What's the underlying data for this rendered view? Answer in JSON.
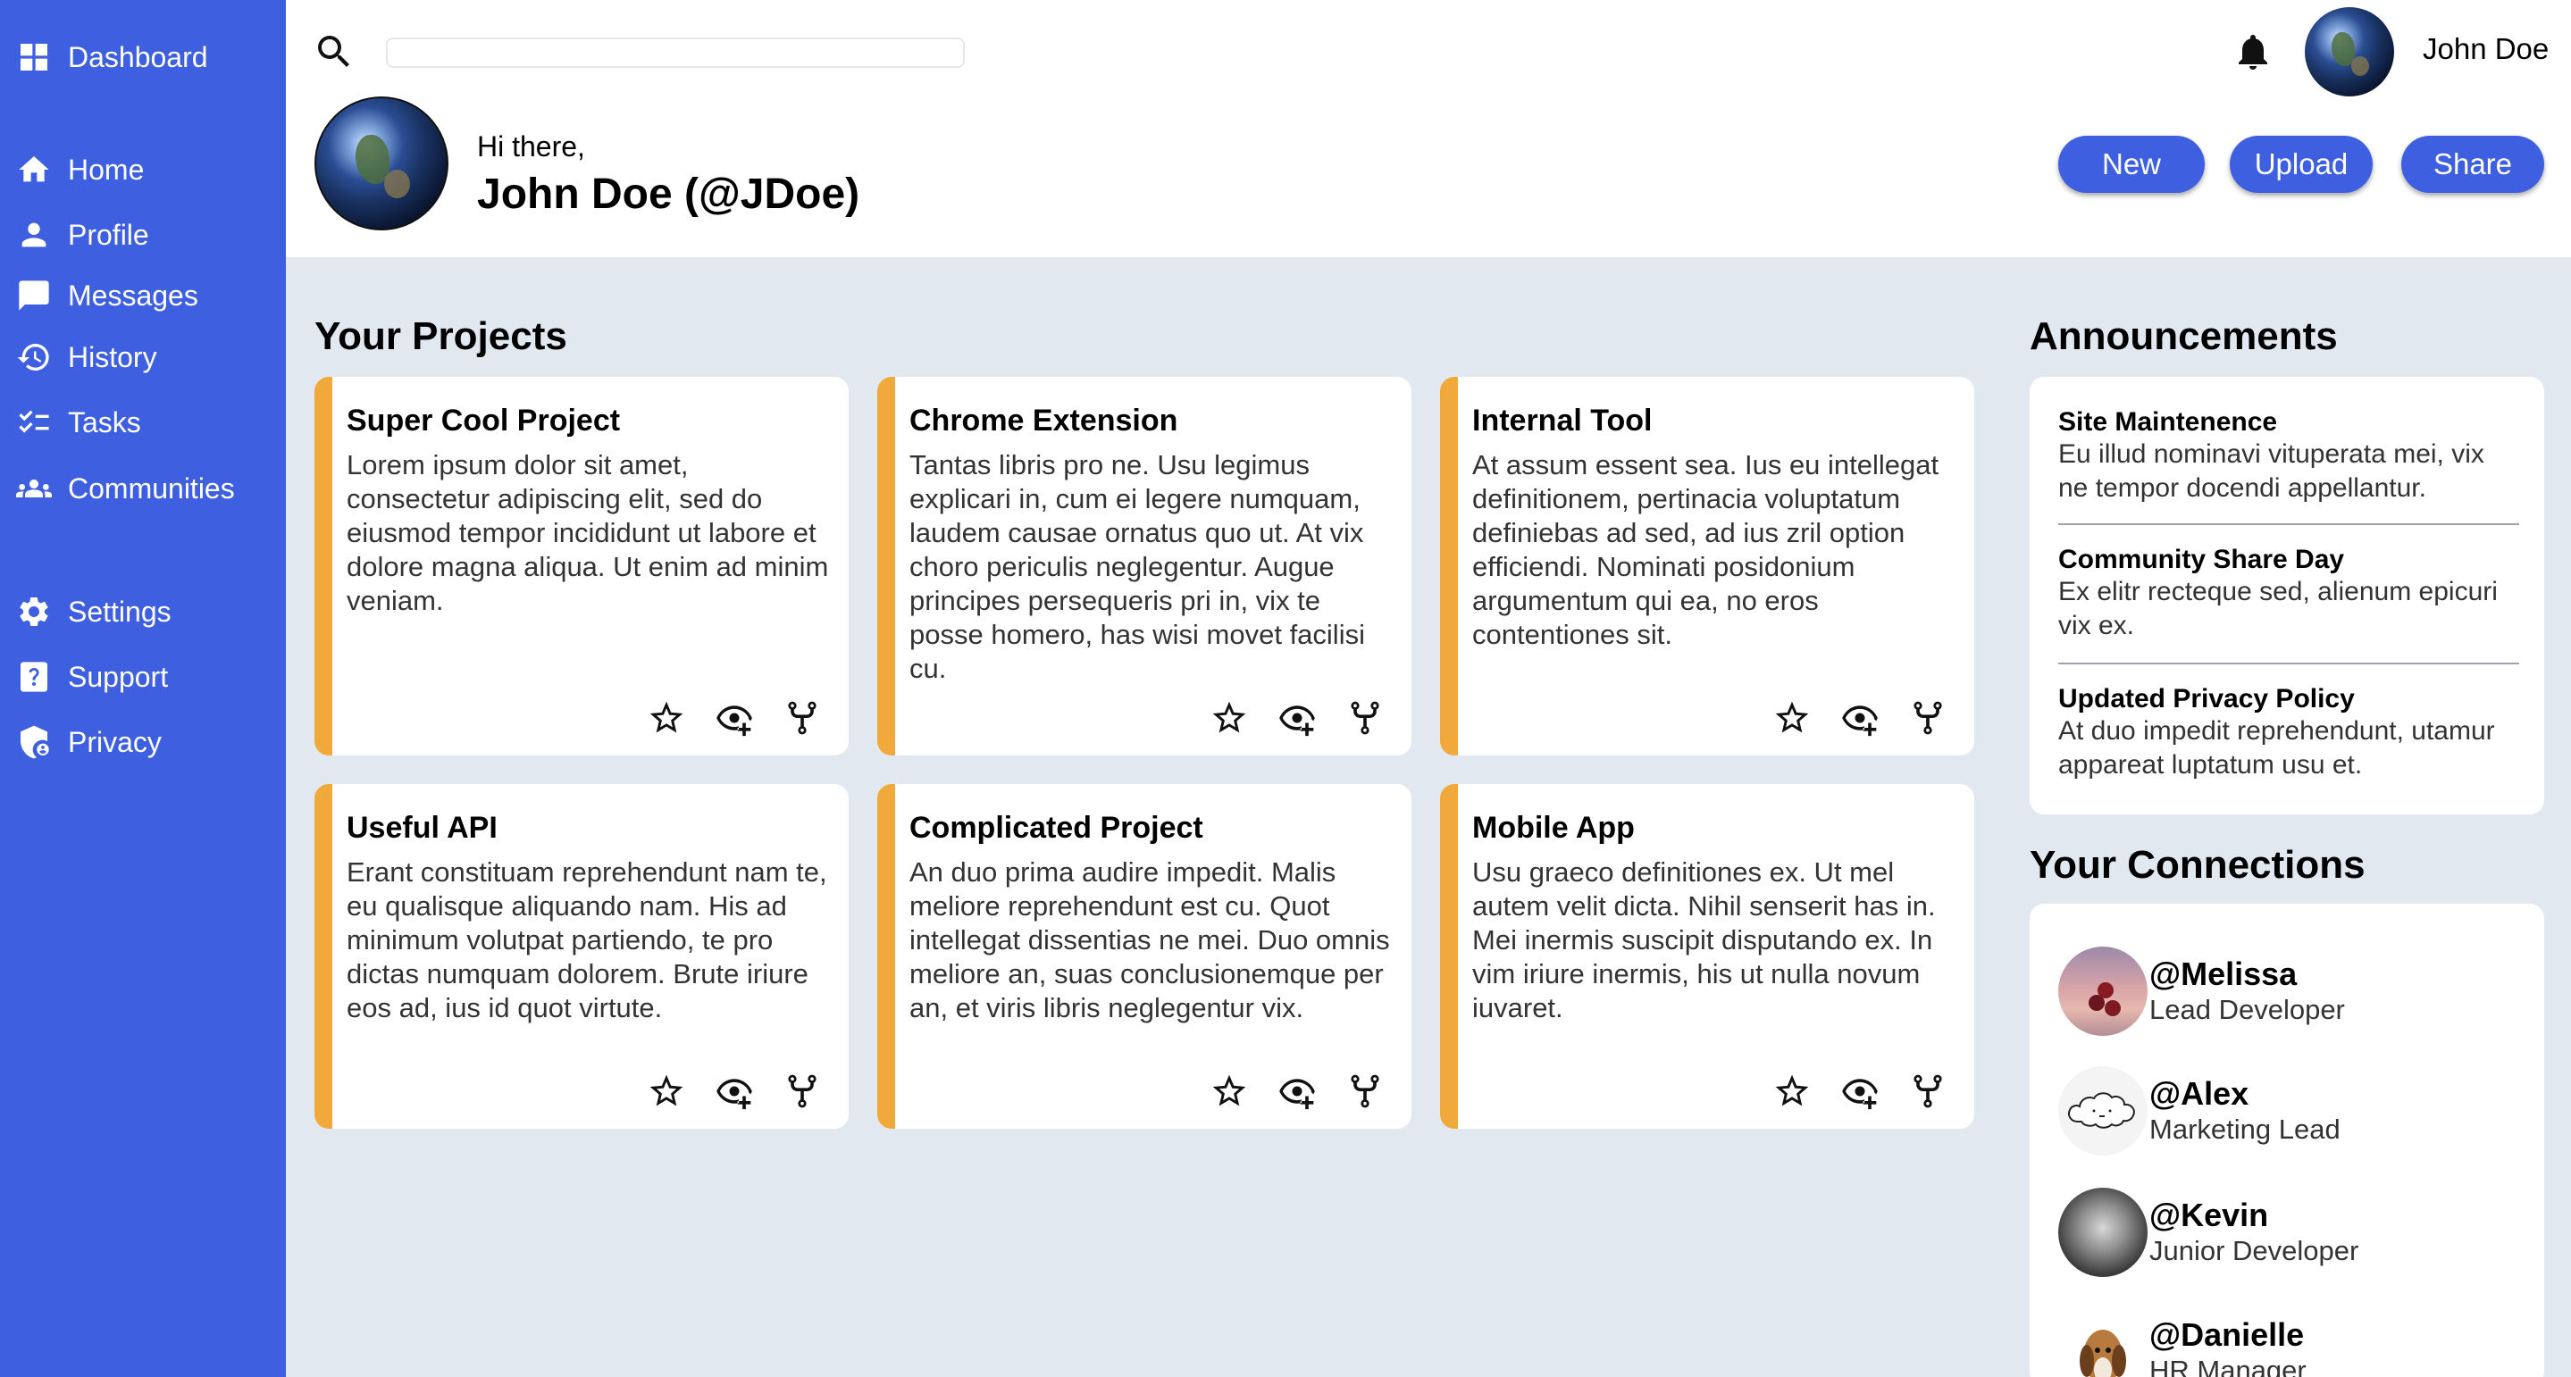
{
  "sidebar": {
    "dashboard": "Dashboard",
    "items": [
      {
        "label": "Home"
      },
      {
        "label": "Profile"
      },
      {
        "label": "Messages"
      },
      {
        "label": "History"
      },
      {
        "label": "Tasks"
      },
      {
        "label": "Communities"
      },
      {
        "label": "Settings"
      },
      {
        "label": "Support"
      },
      {
        "label": "Privacy"
      }
    ]
  },
  "header": {
    "search_placeholder": "",
    "username": "John Doe",
    "greeting": "Hi there,",
    "full_name": "John Doe (@JDoe)",
    "buttons": {
      "new": "New",
      "upload": "Upload",
      "share": "Share"
    }
  },
  "projects": {
    "title": "Your Projects",
    "cards": [
      {
        "title": "Super Cool Project",
        "desc": "Lorem ipsum dolor sit amet, consectetur adipiscing elit, sed do eiusmod tempor incididunt ut labore et dolore magna aliqua. Ut enim ad minim veniam."
      },
      {
        "title": "Chrome Extension",
        "desc": "Tantas libris pro ne. Usu legimus explicari in, cum ei legere numquam, laudem causae ornatus quo ut. At vix choro periculis neglegentur. Augue principes persequeris pri in, vix te posse homero, has wisi movet facilisi cu."
      },
      {
        "title": "Internal Tool",
        "desc": "At assum essent sea. Ius eu intellegat definitionem, pertinacia voluptatum definiebas ad sed, ad ius zril option efficiendi. Nominati posidonium argumentum qui ea, no eros contentiones sit."
      },
      {
        "title": "Useful API",
        "desc": "Erant constituam reprehendunt nam te, eu qualisque aliquando nam. His ad minimum volutpat partiendo, te pro dictas numquam dolorem. Brute iriure eos ad, ius id quot virtute."
      },
      {
        "title": "Complicated Project",
        "desc": "An duo prima audire impedit. Malis meliore reprehendunt est cu. Quot intellegat dissentias ne mei. Duo omnis meliore an, suas conclusionemque per an, et viris libris neglegentur vix."
      },
      {
        "title": "Mobile App",
        "desc": "Usu graeco definitiones ex. Ut mel autem velit dicta. Nihil senserit has in. Mei inermis suscipit disputando ex. In vim iriure inermis, his ut nulla novum iuvaret."
      }
    ]
  },
  "announcements": {
    "title": "Announcements",
    "items": [
      {
        "title": "Site Maintenence",
        "desc": "Eu illud nominavi vituperata mei, vix ne tempor docendi appellantur."
      },
      {
        "title": "Community Share Day",
        "desc": "Ex elitr recteque sed, alienum epicuri vix ex."
      },
      {
        "title": "Updated Privacy Policy",
        "desc": "At duo impedit reprehendunt, utamur appareat luptatum usu et."
      }
    ]
  },
  "connections": {
    "title": "Your Connections",
    "items": [
      {
        "handle": "@Melissa",
        "role": "Lead Developer"
      },
      {
        "handle": "@Alex",
        "role": "Marketing Lead"
      },
      {
        "handle": "@Kevin",
        "role": "Junior Developer"
      },
      {
        "handle": "@Danielle",
        "role": "HR Manager"
      }
    ]
  },
  "colors": {
    "sidebar": "#3e5fe0",
    "accent": "#f0a93a",
    "background": "#e2e8f0"
  }
}
